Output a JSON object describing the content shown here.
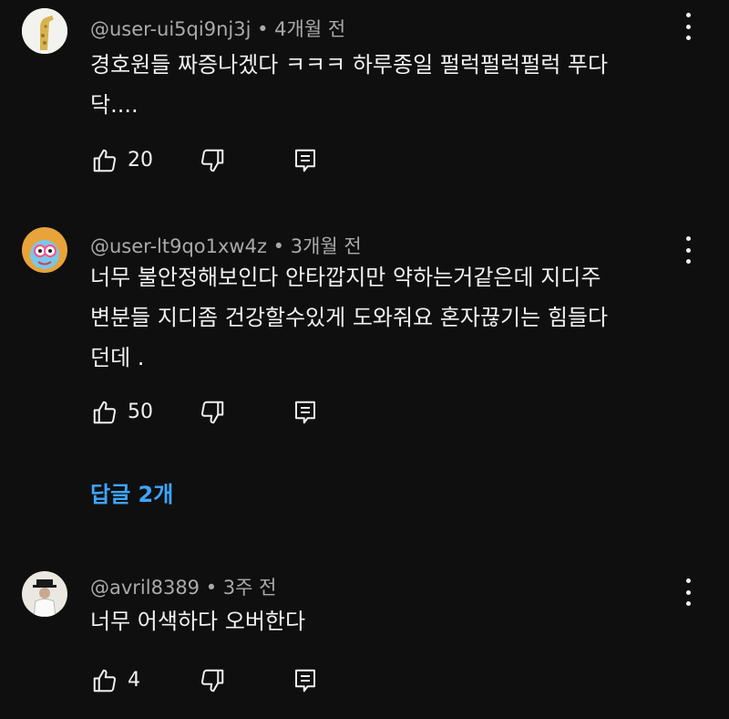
{
  "comments": [
    {
      "user": "@user-ui5qi9nj3j",
      "time": "4개월 전",
      "text": "경호원들 짜증나겠다 ㅋㅋㅋ 하루종일 펄럭펄럭펄럭 푸다\n닥....",
      "likes": "20"
    },
    {
      "user": "@user-lt9qo1xw4z",
      "time": "3개월 전",
      "text": "너무 불안정해보인다 안타깝지만 약하는거같은데 지디주\n변분들 지디좀 건강할수있게 도와줘요 혼자끊기는 힘들다\n던데 .",
      "likes": "50"
    },
    {
      "user": "@avril8389",
      "time": "3주 전",
      "text": "너무 어색하다 오버한다",
      "likes": "4"
    }
  ],
  "separator": " • ",
  "replies_link": "답글 2개",
  "icons": {
    "like": "thumb-up-icon",
    "dislike": "thumb-down-icon",
    "reply": "reply-icon",
    "more": "more-vertical-icon"
  },
  "colors": {
    "background": "#0f0f0f",
    "text": "#f1f1f1",
    "secondary": "#aaaaaa",
    "link": "#3ea6ff"
  }
}
